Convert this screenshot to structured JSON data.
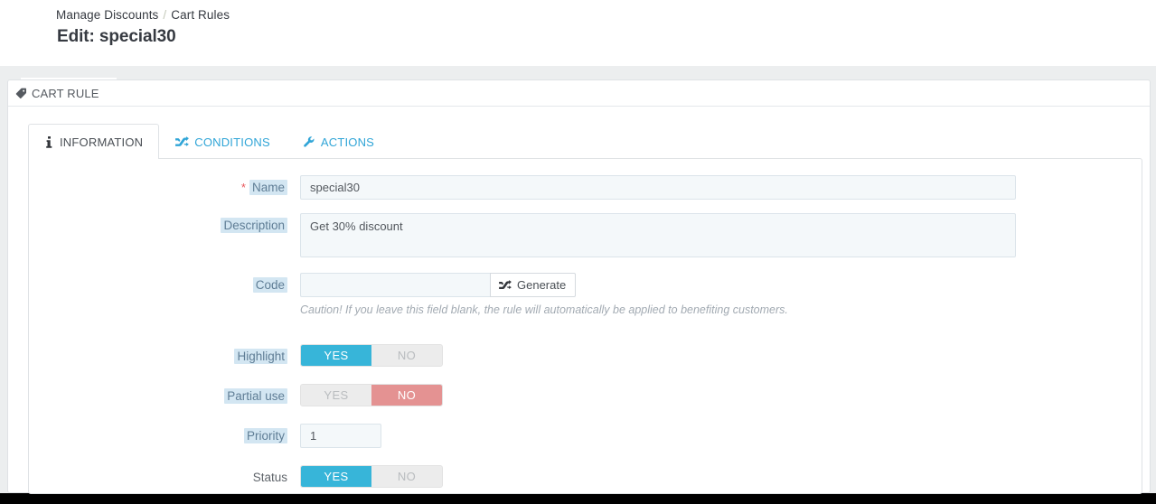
{
  "breadcrumb": {
    "parent": "Manage Discounts",
    "separator": "/",
    "current": "Cart Rules"
  },
  "page": {
    "title": "Edit: special30"
  },
  "panel": {
    "icon": "tag-icon",
    "title": "CART RULE"
  },
  "tabs": [
    {
      "label": "INFORMATION",
      "icon": "info-icon",
      "active": true
    },
    {
      "label": "CONDITIONS",
      "icon": "shuffle-icon",
      "active": false
    },
    {
      "label": "ACTIONS",
      "icon": "wrench-icon",
      "active": false
    }
  ],
  "form": {
    "name": {
      "label": "Name",
      "required_marker": "*",
      "value": "special30",
      "placeholder": ""
    },
    "description": {
      "label": "Description",
      "value": "Get 30% discount",
      "placeholder": ""
    },
    "code": {
      "label": "Code",
      "value": "",
      "placeholder": "",
      "generate_label": "Generate",
      "generate_icon": "shuffle-icon",
      "hint": "Caution! If you leave this field blank, the rule will automatically be applied to benefiting customers."
    },
    "highlight": {
      "label": "Highlight",
      "yes_label": "YES",
      "no_label": "NO",
      "value": "YES"
    },
    "partial_use": {
      "label": "Partial use",
      "yes_label": "YES",
      "no_label": "NO",
      "value": "NO"
    },
    "priority": {
      "label": "Priority",
      "value": "1",
      "placeholder": ""
    },
    "status": {
      "label": "Status",
      "yes_label": "YES",
      "no_label": "NO",
      "value": "YES"
    }
  },
  "colors": {
    "accent_teal": "#37b5d9",
    "toggle_no_red": "#e49292",
    "link_blue": "#30a5d7",
    "label_blue": "#5f7d95",
    "label_highlight": "#d3e6f2",
    "required_red": "#e8575c",
    "page_bg": "#eceeef",
    "input_bg": "#f4f8fa"
  }
}
